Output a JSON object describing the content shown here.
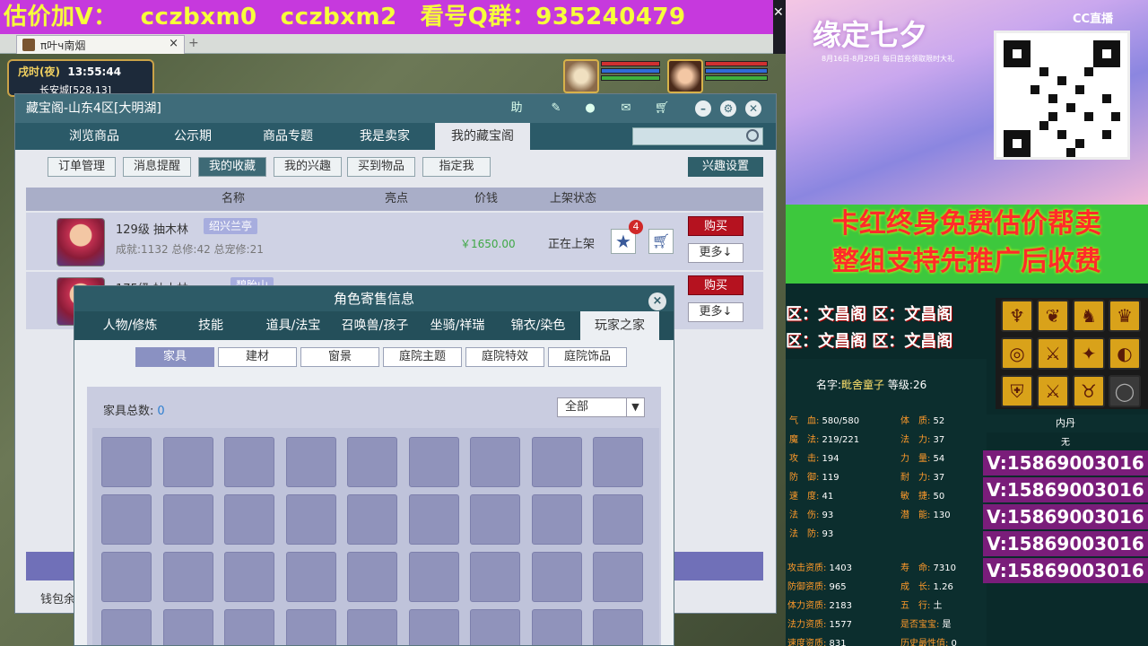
{
  "banner": {
    "prefix": "估价加V：",
    "v1": "cczbxm0",
    "v2": "cczbxm2",
    "q_label": "看号Q群：",
    "q_num": "935240479"
  },
  "browser_tab": {
    "title": "π叶ч南烟",
    "close": "×",
    "add": "+"
  },
  "game_hud": {
    "time": "戌时(夜)",
    "clock": "13:55:44",
    "location": "长安城[528,13]"
  },
  "treasure": {
    "title": "藏宝阁-山东4区[大明湖]",
    "help": "助",
    "nav": [
      "浏览商品",
      "公示期",
      "商品专题",
      "我是卖家",
      "我的藏宝阁"
    ],
    "active_nav": 4,
    "subtabs": [
      "订单管理",
      "消息提醒",
      "我的收藏",
      "我的兴趣",
      "买到物品",
      "指定我"
    ],
    "active_sub": 2,
    "interest_button": "兴趣设置",
    "columns": [
      "名称",
      "亮点",
      "价钱",
      "上架状态"
    ],
    "rows": [
      {
        "name": "129级 抽木林",
        "tag": "绍兴兰亭",
        "stats": "成就:1132 总修:42 总宠修:21",
        "price": "￥1650.00",
        "status": "正在上架",
        "fav_count": "4",
        "buy": "购买",
        "more": "更多↓"
      },
      {
        "name": "175级 抽木林",
        "tag": "碧胎山",
        "stats": "",
        "price": "",
        "status": "",
        "fav_count": "",
        "buy": "购买",
        "more": "更多↓"
      }
    ],
    "wallet": "钱包余"
  },
  "role_info": {
    "title": "角色寄售信息",
    "close": "×",
    "tabs": [
      "人物/修炼",
      "技能",
      "道具/法宝",
      "召唤兽/孩子",
      "坐骑/祥瑞",
      "锦衣/染色",
      "玩家之家"
    ],
    "active_tab": 6,
    "subtabs": [
      "家具",
      "建材",
      "窗景",
      "庭院主题",
      "庭院特效",
      "庭院饰品"
    ],
    "active_sub": 0,
    "furniture_label": "家具总数:",
    "furniture_count": "0",
    "filter": "全部"
  },
  "stream": {
    "event_title": "缘定七夕",
    "event_sub": "8月16日-8月29日 每日首充领取限时大礼",
    "cc": "CC直播",
    "promo1": "卡红终身免费估价帮卖",
    "promo2": "整组支持先推广后收费",
    "zone1": "区：文昌阁 区：文昌阁",
    "zone2": "区：文昌阁 区：文昌阁",
    "char_name_label": "名字:",
    "char_name": "毗舍童子",
    "char_level_label": "等级:",
    "char_level": "26",
    "neidan_title": "内丹",
    "neidan_value": "无",
    "contacts": [
      "V:15869003016",
      "V:15869003016",
      "V:15869003016",
      "V:15869003016",
      "V:15869003016"
    ],
    "stats_left": [
      {
        "label": "气　血:",
        "value": "580/580"
      },
      {
        "label": "魔　法:",
        "value": "219/221"
      },
      {
        "label": "攻　击:",
        "value": "194"
      },
      {
        "label": "防　御:",
        "value": "119"
      },
      {
        "label": "速　度:",
        "value": "41"
      },
      {
        "label": "法　伤:",
        "value": "93"
      },
      {
        "label": "法　防:",
        "value": "93"
      }
    ],
    "stats_right": [
      {
        "label": "体　质:",
        "value": "52"
      },
      {
        "label": "法　力:",
        "value": "37"
      },
      {
        "label": "力　量:",
        "value": "54"
      },
      {
        "label": "耐　力:",
        "value": "37"
      },
      {
        "label": "敏　捷:",
        "value": "50"
      },
      {
        "label": "潜　能:",
        "value": "130"
      }
    ],
    "apt_left": [
      {
        "label": "攻击资质:",
        "value": "1403"
      },
      {
        "label": "防御资质:",
        "value": "965"
      },
      {
        "label": "体力资质:",
        "value": "2183"
      },
      {
        "label": "法力资质:",
        "value": "1577"
      },
      {
        "label": "速度资质:",
        "value": "831"
      }
    ],
    "apt_right": [
      {
        "label": "寿　命:",
        "value": "7310"
      },
      {
        "label": "成　长:",
        "value": "1.26"
      },
      {
        "label": "五　行:",
        "value": "土"
      },
      {
        "label": "是否宝宝:",
        "value": "是"
      },
      {
        "label": "历史最性值:",
        "value": "0"
      }
    ],
    "skill_icons": [
      "curse-icon",
      "bird-icon",
      "dragon-icon",
      "flame-icon",
      "eye-icon",
      "swords-icon",
      "crab-icon",
      "spiral-icon",
      "shield-icon",
      "sword-icon",
      "bull-icon",
      "gray-icon"
    ]
  },
  "colors": {
    "banner_bg": "#c639dd",
    "banner_text": "#f7ff3b",
    "window_header": "#3f6c7a",
    "buy_red": "#b5121f",
    "promo_red": "#ff2b2b",
    "contact_bg": "#7a1d7a"
  }
}
